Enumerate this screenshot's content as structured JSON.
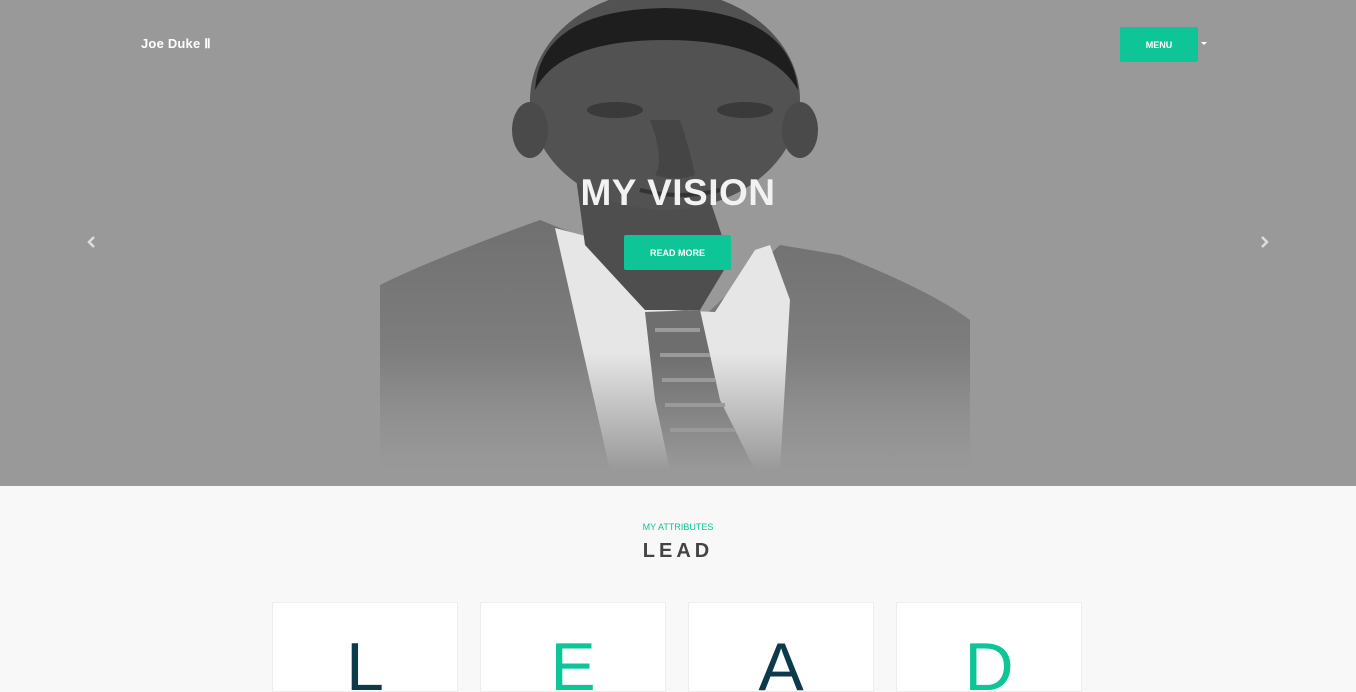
{
  "header": {
    "brand": "Joe Duke Ⅱ",
    "menu_label": "MENU"
  },
  "hero": {
    "title": "MY VISION",
    "cta_label": "READ MORE",
    "prev_icon": "chevron-left-icon",
    "next_icon": "chevron-right-icon",
    "portrait": "man-in-suit-portrait"
  },
  "attributes": {
    "kicker": "MY ATTRIBUTES",
    "title": "LEAD",
    "cards": [
      {
        "letter": "L",
        "color": "#0b3a4a"
      },
      {
        "letter": "E",
        "color": "#0ec597"
      },
      {
        "letter": "A",
        "color": "#0b3a4a"
      },
      {
        "letter": "D",
        "color": "#0ec597"
      }
    ]
  },
  "colors": {
    "accent": "#0ec597",
    "dark": "#0b3a4a",
    "hero_bg": "#999999"
  }
}
